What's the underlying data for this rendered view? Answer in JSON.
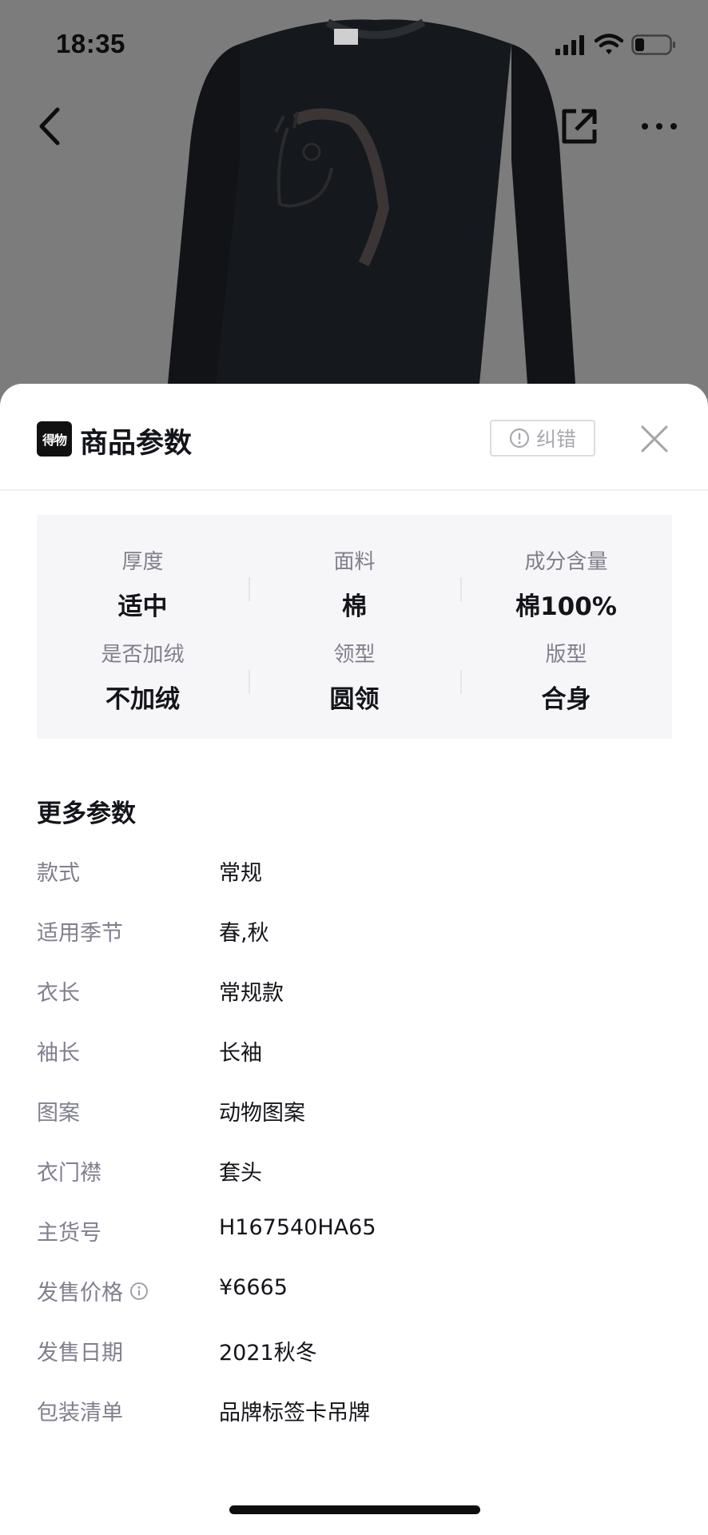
{
  "status_bar": {
    "time": "18:35"
  },
  "sheet": {
    "logo_text": "得物",
    "title": "商品参数",
    "report_label": "纠错"
  },
  "key_params": [
    {
      "label": "厚度",
      "value": "适中"
    },
    {
      "label": "面料",
      "value": "棉"
    },
    {
      "label": "成分含量",
      "value": "棉100%"
    },
    {
      "label": "是否加绒",
      "value": "不加绒"
    },
    {
      "label": "领型",
      "value": "圆领"
    },
    {
      "label": "版型",
      "value": "合身"
    }
  ],
  "more_params": {
    "title": "更多参数",
    "rows": [
      {
        "label": "款式",
        "value": "常规"
      },
      {
        "label": "适用季节",
        "value": "春,秋"
      },
      {
        "label": "衣长",
        "value": "常规款"
      },
      {
        "label": "袖长",
        "value": "长袖"
      },
      {
        "label": "图案",
        "value": "动物图案"
      },
      {
        "label": "衣门襟",
        "value": "套头"
      },
      {
        "label": "主货号",
        "value": "H167540HA65"
      },
      {
        "label": "发售价格",
        "value": "¥6665",
        "info_icon": true
      },
      {
        "label": "发售日期",
        "value": "2021秋冬"
      },
      {
        "label": "包装清单",
        "value": "品牌标签卡吊牌"
      }
    ]
  },
  "colors": {
    "overlay_gray": "#7d7d7d",
    "sweater": "#15181c",
    "text_primary": "#14151a",
    "text_secondary": "#7f7f8e",
    "panel_bg": "#f6f6f8"
  }
}
